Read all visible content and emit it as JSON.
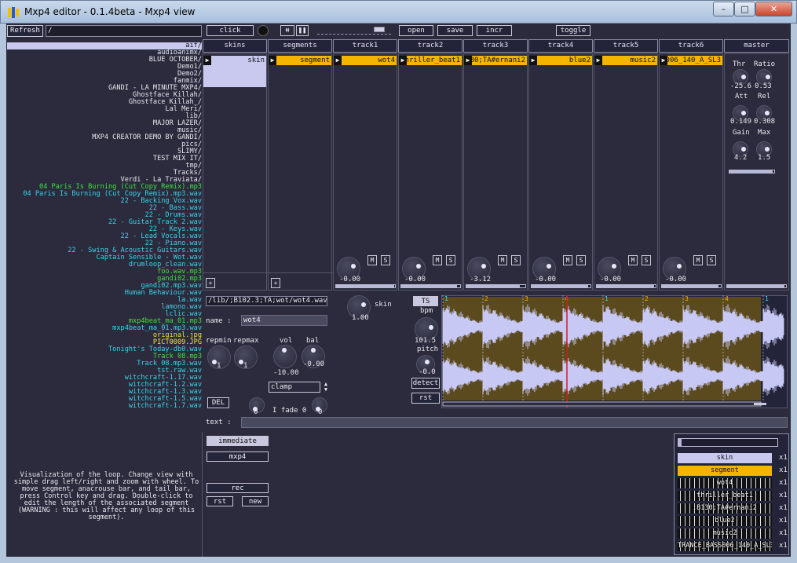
{
  "window": {
    "title": "Mxp4 editor - 0.1.4beta - Mxp4 view",
    "minimize": "–",
    "maximize": "□",
    "close": "✕"
  },
  "top": {
    "refresh": "Refresh",
    "path": "/",
    "click": "click",
    "open": "open",
    "save": "save",
    "incr": "incr",
    "toggle": "toggle",
    "transport_progress": 0.9
  },
  "files": [
    {
      "name": "aif/",
      "color": "#e8e8f0"
    },
    {
      "name": "audioanimx/",
      "color": "#e8e8f0"
    },
    {
      "name": "BLUE OCTOBER/",
      "color": "#e8e8f0"
    },
    {
      "name": "Demo1/",
      "color": "#e8e8f0"
    },
    {
      "name": "Demo2/",
      "color": "#e8e8f0"
    },
    {
      "name": "fanmix/",
      "color": "#e8e8f0"
    },
    {
      "name": "GANDI - LA MINUTE MXP4/",
      "color": "#e8e8f0"
    },
    {
      "name": "Ghostface Killah/",
      "color": "#e8e8f0"
    },
    {
      "name": "Ghostface Killah_/",
      "color": "#e8e8f0"
    },
    {
      "name": "Lal Meri/",
      "color": "#e8e8f0"
    },
    {
      "name": "lib/",
      "color": "#e8e8f0"
    },
    {
      "name": "MAJOR LAZER/",
      "color": "#e8e8f0"
    },
    {
      "name": "music/",
      "color": "#e8e8f0"
    },
    {
      "name": "MXP4 CREATOR DEMO BY GANDI/",
      "color": "#e8e8f0"
    },
    {
      "name": "pics/",
      "color": "#e8e8f0"
    },
    {
      "name": "SLIMY/",
      "color": "#e8e8f0"
    },
    {
      "name": "TEST MIX IT/",
      "color": "#e8e8f0"
    },
    {
      "name": "tmp/",
      "color": "#e8e8f0"
    },
    {
      "name": "Tracks/",
      "color": "#e8e8f0"
    },
    {
      "name": "Verdi - La Traviata/",
      "color": "#e8e8f0"
    },
    {
      "name": "04 Paris Is Burning (Cut Copy Remix).mp3",
      "color": "#3fe03f"
    },
    {
      "name": "04 Paris Is Burning (Cut Copy Remix).mp3.wav",
      "color": "#37d6e8"
    },
    {
      "name": "22 - Backing Vox.wav",
      "color": "#37d6e8"
    },
    {
      "name": "22 - Bass.wav",
      "color": "#37d6e8"
    },
    {
      "name": "22 - Drums.wav",
      "color": "#37d6e8"
    },
    {
      "name": "22 - Guitar Track 2.wav",
      "color": "#37d6e8"
    },
    {
      "name": "22 - Keys.wav",
      "color": "#37d6e8"
    },
    {
      "name": "22 - Lead Vocals.wav",
      "color": "#37d6e8"
    },
    {
      "name": "22 - Piano.wav",
      "color": "#37d6e8"
    },
    {
      "name": "22 - Swing & Acoustic Guitars.wav",
      "color": "#37d6e8"
    },
    {
      "name": "Captain Sensible - Wot.wav",
      "color": "#37d6e8"
    },
    {
      "name": "drumloop_clean.wav",
      "color": "#37d6e8"
    },
    {
      "name": "foo.wav.mp3",
      "color": "#3fe03f"
    },
    {
      "name": "gandi02.mp3",
      "color": "#3fe03f"
    },
    {
      "name": "gandi02.mp3.wav",
      "color": "#37d6e8"
    },
    {
      "name": "Human Behaviour.wav",
      "color": "#37d6e8"
    },
    {
      "name": "la.wav",
      "color": "#37d6e8"
    },
    {
      "name": "lamono.wav",
      "color": "#37d6e8"
    },
    {
      "name": "lclic.wav",
      "color": "#37d6e8"
    },
    {
      "name": "mxp4beat_ma_01.mp3",
      "color": "#3fe03f"
    },
    {
      "name": "mxp4beat_ma_01.mp3.wav",
      "color": "#37d6e8"
    },
    {
      "name": "original.jpg",
      "color": "#f0e040"
    },
    {
      "name": "PICT0009.JPG",
      "color": "#f0e040"
    },
    {
      "name": "Tonight's Today-db0.wav",
      "color": "#37d6e8"
    },
    {
      "name": "Track 08.mp3",
      "color": "#3fe03f"
    },
    {
      "name": "Track 08.mp3.wav",
      "color": "#37d6e8"
    },
    {
      "name": "tst.raw.wav",
      "color": "#37d6e8"
    },
    {
      "name": "witchcraft-1.17.wav",
      "color": "#37d6e8"
    },
    {
      "name": "witchcraft-1.2.wav",
      "color": "#37d6e8"
    },
    {
      "name": "witchcraft-1.3.wav",
      "color": "#37d6e8"
    },
    {
      "name": "witchcraft-1.5.wav",
      "color": "#37d6e8"
    },
    {
      "name": "witchcraft-1.7.wav",
      "color": "#37d6e8"
    }
  ],
  "columns": {
    "skins": {
      "header": "skins",
      "item": "skin"
    },
    "segments": {
      "header": "segments",
      "item": "segment"
    },
    "tracks": [
      {
        "header": "track1",
        "item": "wot4",
        "vol": "-0.00",
        "level": 0.98
      },
      {
        "header": "track2",
        "item": "thriller_beat1",
        "vol": "-0.00",
        "level": 0.95
      },
      {
        "header": "track3",
        "item": "B0;TA#ernani2",
        "vol": "-3.12",
        "level": 0.9
      },
      {
        "header": "track4",
        "item": "blue2",
        "vol": "-0.00",
        "level": 0.96
      },
      {
        "header": "track5",
        "item": "music2",
        "vol": "-0.00",
        "level": 0.97
      },
      {
        "header": "track6",
        "item": "006_140_A_SL3",
        "vol": "-0.00",
        "level": 0.96
      }
    ],
    "m": "M",
    "s": "S",
    "add": "+"
  },
  "master": {
    "header": "master",
    "thr": "Thr",
    "ratio": "Ratio",
    "thr_val": "-25.6",
    "ratio_val": "0.53",
    "att": "Att",
    "rel": "Rel",
    "att_val": "0.149",
    "rel_val": "0.308",
    "gain": "Gain",
    "max": "Max",
    "gain_val": "4.2",
    "max_val": "1.5",
    "level": 0.97
  },
  "editor": {
    "path": "/lib/;B102.3;TA;wot/wot4.wav",
    "name_label": "name :",
    "name_value": "wot4",
    "skin_label": "skin",
    "skin_val": "1.00",
    "repmin": "repmin",
    "repmax": "repmax",
    "repmin_val": "1",
    "repmax_val": "1",
    "vol": "vol",
    "bal": "bal",
    "vol_val": "-10.00",
    "bal_val": "-0.00",
    "clamp": "clamp",
    "del": "DEL",
    "ifade": "I fade 0",
    "fade_l": "0",
    "fade_r": "0",
    "text_label": "text :",
    "ts": "TS",
    "bpm": "bpm",
    "bpm_val": "101.5",
    "pitch": "pitch",
    "pitch_val": "-0.0",
    "detect": "detect",
    "rst": "rst"
  },
  "waveform": {
    "markers": [
      "1",
      "2",
      "3",
      "4",
      "1",
      "2",
      "3",
      "4",
      "1"
    ],
    "fill_color": "#5a4a1e",
    "wave_color": "#c8c8f4",
    "cursor_color": "#e01818"
  },
  "help": {
    "text": "Visualization of the loop. Change view with simple drag left/right and zoom with wheel. To move segment, anacrouse bar, and tail bar, press Control key and drag. Double-click to edit the length of the associated segment (WARNING : this will affect any loop of this segment)."
  },
  "bottom_controls": {
    "immediate": "immediate",
    "mxp4": "mxp4",
    "rec": "rec",
    "rst": "rst",
    "new": "new"
  },
  "legend": [
    {
      "label": "skin",
      "count": "x1",
      "style": "lav"
    },
    {
      "label": "segment",
      "count": "x1",
      "style": "gold"
    },
    {
      "label": "wot4",
      "count": "x1",
      "style": "wave"
    },
    {
      "label": "thriller_beat1",
      "count": "x1",
      "style": "wave"
    },
    {
      "label": ";B130;TA#ernani2",
      "count": "x1",
      "style": "wave"
    },
    {
      "label": "blue2",
      "count": "x1",
      "style": "wave"
    },
    {
      "label": "music2",
      "count": "x1",
      "style": "wave"
    },
    {
      "label": "TRANCE_BASS006_140_A_SL3",
      "count": "x1",
      "style": "wave"
    }
  ]
}
